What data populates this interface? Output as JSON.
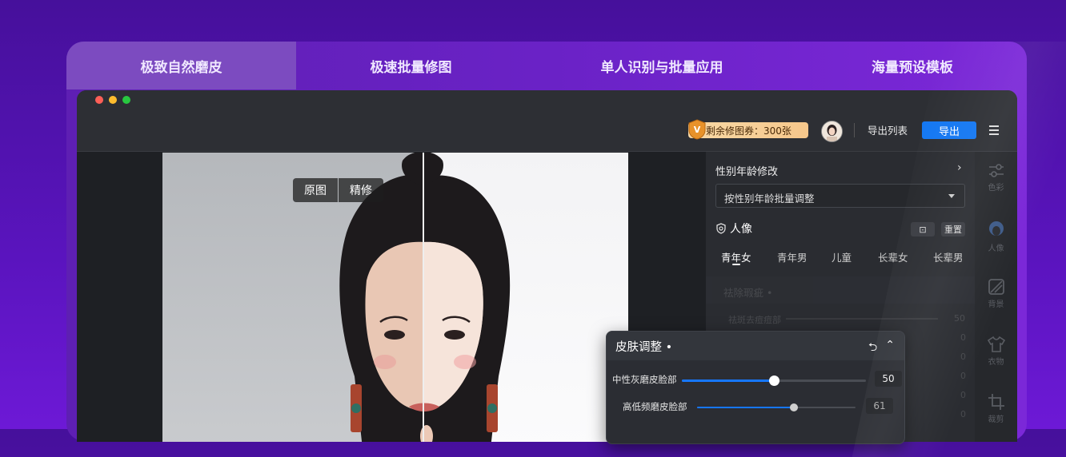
{
  "feature_tabs": [
    {
      "label": "极致自然磨皮"
    },
    {
      "label": "极速批量修图"
    },
    {
      "label": "单人识别与批量应用"
    },
    {
      "label": "海量预设模板"
    }
  ],
  "topbar": {
    "voucher_icon": "V",
    "voucher_text": "剩余修图券：300张",
    "export_list": "导出列表",
    "export_button": "导出"
  },
  "compare": {
    "left": "原图",
    "right": "精修"
  },
  "panel": {
    "section_title": "性别年龄修改",
    "select_value": "按性别年龄批量调整",
    "portrait_title": "人像",
    "reset": "重置",
    "person_tabs": [
      "青年女",
      "青年男",
      "儿童",
      "长辈女",
      "长辈男"
    ],
    "faded_section": "祛除瑕疵 •",
    "faded_slider_label": "祛斑去痘痘部",
    "faded_values": [
      "50",
      "0",
      "0",
      "0",
      "0",
      "0"
    ]
  },
  "side_icons": [
    {
      "label": "色彩"
    },
    {
      "label": "人像"
    },
    {
      "label": "背景"
    },
    {
      "label": "衣物"
    },
    {
      "label": "裁剪"
    }
  ],
  "skin_popup": {
    "title": "皮肤调整 •",
    "sliders": [
      {
        "label": "中性灰磨皮脸部",
        "value": "50",
        "level": 0.5
      },
      {
        "label": "高低频磨皮脸部",
        "value": "61",
        "level": 0.61
      }
    ]
  },
  "colors": {
    "accent": "#1377f2",
    "bg_purple": "#5a14be",
    "voucher": "#f6c78b"
  }
}
